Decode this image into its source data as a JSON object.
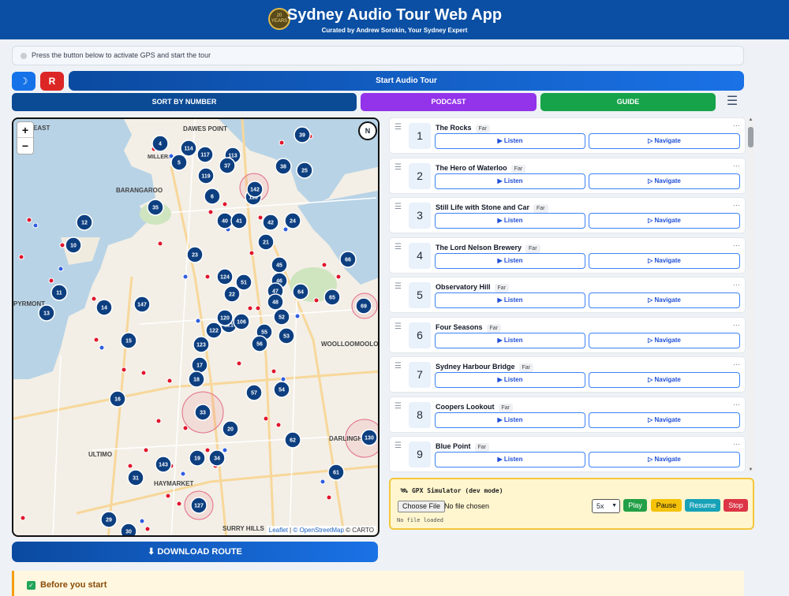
{
  "header": {
    "title": "Sydney Audio Tour Web App",
    "subtitle": "Curated by Andrew Sorokin, Your Sydney Expert",
    "logo_text": "20 YEARS IN SYDNEY"
  },
  "status": {
    "message": "Press the button below to activate GPS and start the tour"
  },
  "controls": {
    "theme_icon": "☽",
    "reset_label": "R",
    "start_label": "Start Audio Tour"
  },
  "tabs": {
    "sort_label": "SORT BY NUMBER",
    "podcast_label": "PODCAST",
    "guide_label": "GUIDE",
    "menu_icon": "☰"
  },
  "map": {
    "zoom_in": "+",
    "zoom_out": "−",
    "compass": "N",
    "attribution": {
      "leaflet": "Leaflet",
      "sep": "|",
      "osm": "© OpenStreetMap",
      "carto": "© CARTO"
    },
    "place_labels": [
      "DAWES POINT",
      "BARANGAROO",
      "PYRMONT",
      "ULTIMO",
      "HAYMARKET",
      "WOOLLOOMOOLOO",
      "DARLINGH",
      "SURRY HILLS",
      "EAST",
      "MILLERS"
    ],
    "markers": [
      "4",
      "114",
      "117",
      "113",
      "5",
      "37",
      "119",
      "39",
      "38",
      "25",
      "6",
      "116",
      "35",
      "12",
      "40",
      "41",
      "42",
      "24",
      "10",
      "21",
      "23",
      "66",
      "124",
      "51",
      "45",
      "46",
      "64",
      "65",
      "69",
      "11",
      "14",
      "147",
      "13",
      "47",
      "48",
      "52",
      "122",
      "121",
      "106",
      "123",
      "55",
      "56",
      "53",
      "15",
      "17",
      "18",
      "57",
      "54",
      "16",
      "33",
      "20",
      "62",
      "130",
      "19",
      "34",
      "143",
      "31",
      "61",
      "127",
      "29",
      "30",
      "22",
      "142",
      "120"
    ]
  },
  "download_label": "⬇ DOWNLOAD ROUTE",
  "before_label": "Before you start",
  "stops": [
    {
      "num": "1",
      "name": "The Rocks",
      "tag": "Far"
    },
    {
      "num": "2",
      "name": "The Hero of Waterloo",
      "tag": "Far"
    },
    {
      "num": "3",
      "name": "Still Life with Stone and Car",
      "tag": "Far"
    },
    {
      "num": "4",
      "name": "The Lord Nelson Brewery",
      "tag": "Far"
    },
    {
      "num": "5",
      "name": "Observatory Hill",
      "tag": "Far"
    },
    {
      "num": "6",
      "name": "Four Seasons",
      "tag": "Far"
    },
    {
      "num": "7",
      "name": "Sydney Harbour Bridge",
      "tag": "Far"
    },
    {
      "num": "8",
      "name": "Coopers Lookout",
      "tag": "Far"
    },
    {
      "num": "9",
      "name": "Blue Point",
      "tag": "Far"
    }
  ],
  "stop_buttons": {
    "listen": "▶ Listen",
    "navigate": "▷ Navigate",
    "more": "…",
    "handle": "☰"
  },
  "gpx": {
    "title": "🛰 GPX Simulator (dev mode)",
    "choose_file": "Choose File",
    "no_file_chosen": "No file chosen",
    "speed": "5x",
    "play": "Play",
    "pause": "Pause",
    "resume": "Resume",
    "stop": "Stop",
    "status": "No file loaded"
  }
}
